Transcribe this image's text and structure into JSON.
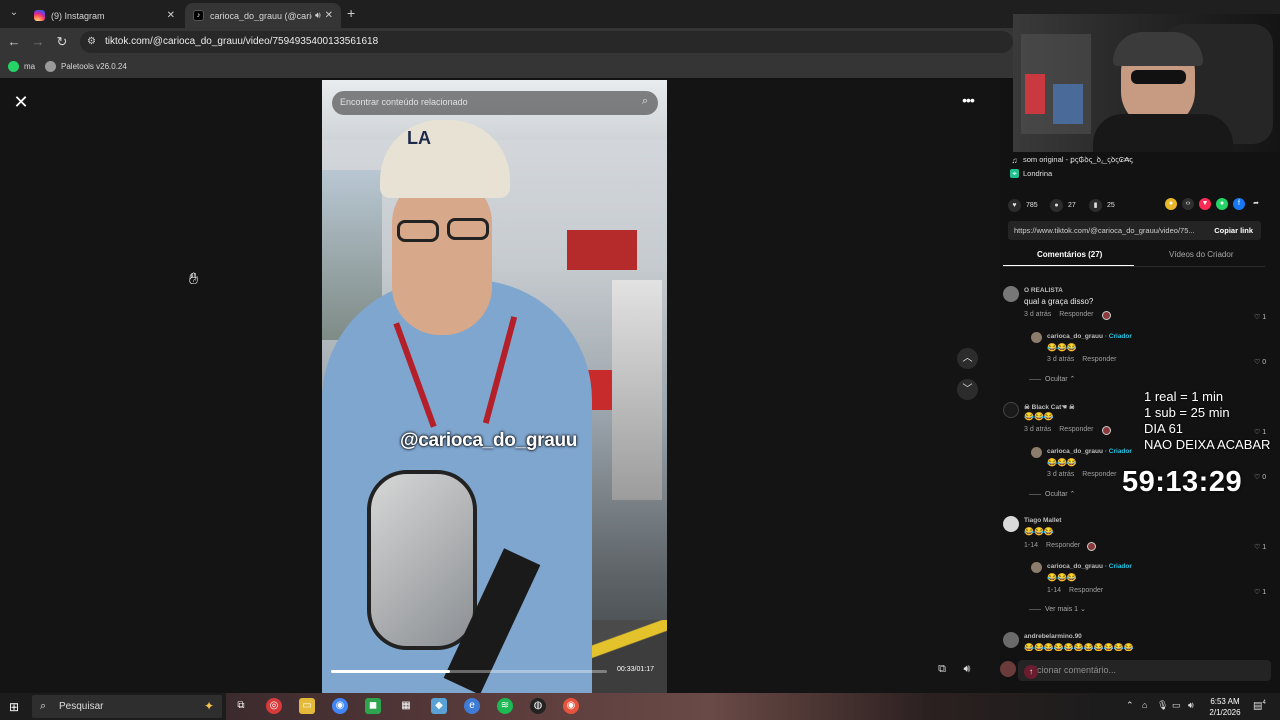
{
  "browser": {
    "tabs": [
      {
        "label": "(9) Instagram",
        "icon": "instagram-icon",
        "active": false
      },
      {
        "label": "carioca_do_grauu (@carioca",
        "icon": "tiktok-icon",
        "active": true
      }
    ],
    "url": "tiktok.com/@carioca_do_grauu/video/7594935400133561618",
    "bookmarks": [
      {
        "label": "ma",
        "icon": "whatsapp-icon"
      },
      {
        "label": "Paletools v26.0.24",
        "icon": "globe-icon"
      }
    ]
  },
  "video": {
    "search_placeholder": "Encontrar conteúdo relacionado",
    "caption": "@carioca_do_grauu",
    "time_current": "00:33",
    "time_total": "01:17",
    "timecode": "00:33/01:17",
    "progress": 0.43
  },
  "panel": {
    "sound": "som original - ꝑꞔ₲ꝺꞔ_ꝺ⁁_ꞔꝺꞔ₢₳ꞔ",
    "location": "Londrina",
    "likes": "785",
    "comments": "27",
    "saves": "25",
    "link": "https://www.tiktok.com/@carioca_do_grauu/video/75...",
    "copy_label": "Copiar link",
    "tab_comments": "Comentários (27)",
    "tab_videos": "Vídeos do Criador"
  },
  "comments": [
    {
      "user": "O REALISTA",
      "text": "qual a graça disso?",
      "time": "3 d atrás",
      "reply": "Responder",
      "likes": "1"
    },
    {
      "user": "carioca_do_grauu",
      "creator": "· Criador",
      "text": "😂😂😂",
      "time": "3 d atrás",
      "reply": "Responder",
      "likes": "0"
    },
    {
      "toggle": "Ocultar ⌃"
    },
    {
      "user": "☠︎ Black Cat☚ ☠︎",
      "text": "😂😂😂",
      "time": "3 d atrás",
      "reply": "Responder",
      "likes": "1"
    },
    {
      "user": "carioca_do_grauu",
      "creator": "· Criador",
      "text": "😂😂😂",
      "time": "3 d atrás",
      "reply": "Responder",
      "likes": "0"
    },
    {
      "toggle": "Ocultar ⌃"
    },
    {
      "user": "Tiago Mallet",
      "text": "😂😂😂",
      "time": "1-14",
      "reply": "Responder",
      "likes": "1"
    },
    {
      "user": "carioca_do_grauu",
      "creator": "· Criador",
      "text": "😂😂😂",
      "time": "1-14",
      "reply": "Responder",
      "likes": "1"
    },
    {
      "toggle": "Ver mais 1 ⌄"
    },
    {
      "user": "andrebelarmino.90",
      "text": "😂😂😂😂😂😂😂😂😂😂😂"
    }
  ],
  "comment_input_placeholder": "Adicionar comentário...",
  "stream_overlay": {
    "lines": [
      "1 real = 1 min",
      "1 sub = 25 min",
      "DIA 61",
      "NAO DEIXA ACABAR"
    ],
    "timer": "59:13:29"
  },
  "taskbar": {
    "search_label": "Pesquisar",
    "time": "6:53 AM",
    "date": "2/1/2026",
    "notifications": "4"
  },
  "colors": {
    "accent_tiktok": "#fe2c55",
    "creator_badge": "#27c4e2"
  }
}
